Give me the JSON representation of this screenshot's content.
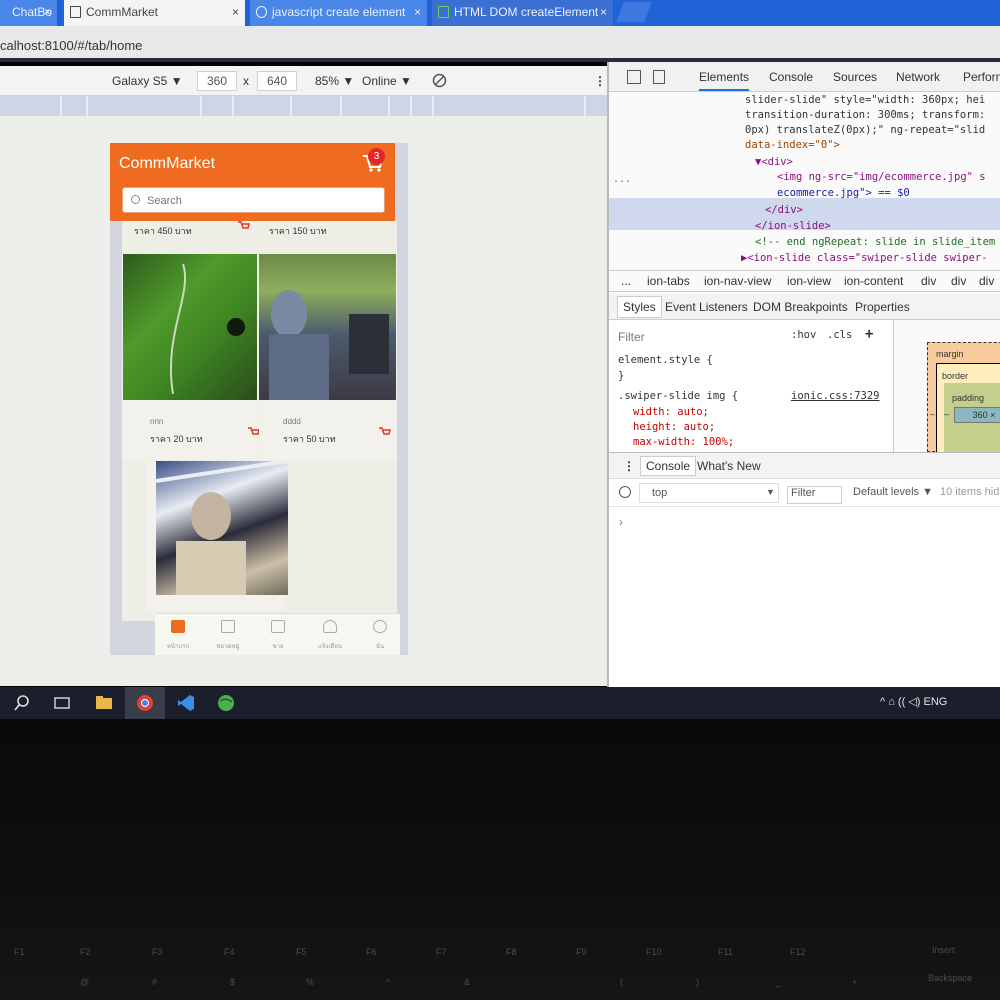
{
  "browser": {
    "tabs": [
      {
        "title": "ChatBo",
        "close": "×"
      },
      {
        "title": "CommMarket",
        "close": "×"
      },
      {
        "title": "javascript create element",
        "close": "×"
      },
      {
        "title": "HTML DOM createElement",
        "close": "×"
      }
    ],
    "url": "calhost:8100/#/tab/home"
  },
  "device_toolbar": {
    "device": "Galaxy S5 ▼",
    "width": "360",
    "times": "x",
    "height": "640",
    "zoom": "85% ▼",
    "network": "Online ▼",
    "more": "⋮"
  },
  "app": {
    "title": "CommMarket",
    "cart_count": "3",
    "search_placeholder": "Search",
    "top_prices": [
      "ราคา 450 บาท",
      "ราคา 150 บาท"
    ],
    "products": [
      {
        "name": "nnn",
        "price": "ราคา 20 บาท"
      },
      {
        "name": "dddd",
        "price": "ราคา 50 บาท"
      }
    ],
    "tabs": [
      "หน้าแรก",
      "หมวดหมู่",
      "ขาย",
      "แจ้งเตือน",
      "ฉัน"
    ],
    "accent": "#ef6b1f"
  },
  "devtools": {
    "tabs": [
      "Elements",
      "Console",
      "Sources",
      "Network",
      "Perform"
    ],
    "dom_lines": [
      "slider-slide\" style=\"width: 360px; hei",
      "transition-duration: 300ms; transform:",
      "0px) translateZ(0px);\" ng-repeat=\"slid",
      "data-index=\"0\">",
      "▼<div>",
      "<img ng-src=\"img/ecommerce.jpg\" s",
      "ecommerce.jpg\"> == $0",
      "</div>",
      "</ion-slide>",
      "<!-- end ngRepeat: slide in slide_item",
      "▶<ion-slide class=\"swiper-slide swiper-"
    ],
    "breadcrumbs": [
      "...",
      "ion-tabs",
      "ion-nav-view",
      "ion-view",
      "ion-content",
      "div",
      "div",
      "div"
    ],
    "subtabs": [
      "Styles",
      "Event Listeners",
      "DOM Breakpoints",
      "Properties"
    ],
    "styles": {
      "filter": "Filter",
      "hov": ":hov",
      "cls": ".cls",
      "plus": "+",
      "rules": [
        "element.style {",
        "}",
        ".swiper-slide img {",
        "width: auto;",
        "height: auto;",
        "max-width: 100%;"
      ],
      "source": "ionic.css:7329"
    },
    "box_model": {
      "margin": "margin",
      "border": "border",
      "padding": "padding",
      "content": "360 ×",
      "dash": "–"
    },
    "drawer_tabs": [
      "Console",
      "What's New"
    ],
    "console": {
      "context": "top",
      "filter": "Filter",
      "levels": "Default levels ▼",
      "hidden": "10 items hid",
      "prompt": "›"
    }
  },
  "taskbar": {
    "tray": "^  ⌂  ((  ◁)  ENG"
  },
  "keyboard": {
    "keys_row1": [
      "F1",
      "F2",
      "F3",
      "F4",
      "F5",
      "F6",
      "F7",
      "F8",
      "F9",
      "F10",
      "F11",
      "F12",
      "Insert"
    ],
    "keys_row2": [
      "@",
      "#",
      "$",
      "%",
      "^",
      "&",
      "(",
      ")",
      "_",
      "+",
      "Backspace"
    ]
  }
}
